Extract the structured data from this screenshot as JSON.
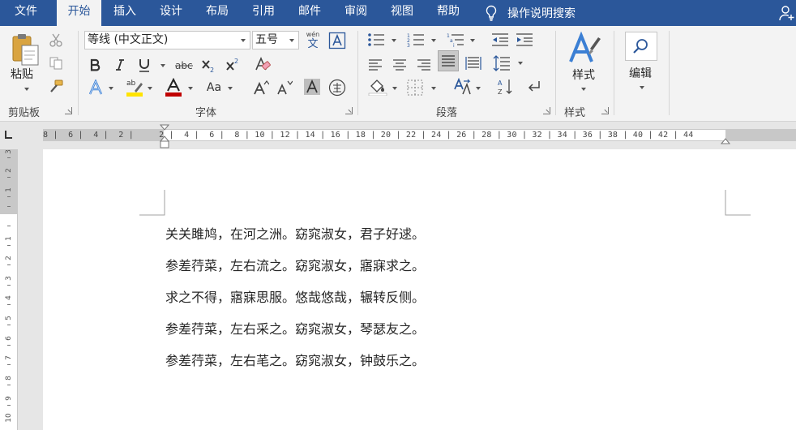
{
  "tabs": [
    {
      "label": "文件"
    },
    {
      "label": "开始"
    },
    {
      "label": "插入"
    },
    {
      "label": "设计"
    },
    {
      "label": "布局"
    },
    {
      "label": "引用"
    },
    {
      "label": "邮件"
    },
    {
      "label": "审阅"
    },
    {
      "label": "视图"
    },
    {
      "label": "帮助"
    }
  ],
  "tell_me": "操作说明搜索",
  "clipboard": {
    "paste_label": "粘贴",
    "group_label": "剪贴板"
  },
  "font": {
    "family": "等线 (中文正文)",
    "size": "五号",
    "group_label": "字体",
    "aa_label": "Aa",
    "phonetic_top": "wén",
    "phonetic_bottom": "文"
  },
  "paragraph": {
    "group_label": "段落"
  },
  "styles": {
    "button_label": "样式",
    "group_label": "样式"
  },
  "editing": {
    "button_label": "编辑"
  },
  "ruler": {
    "numbers": "8 |  6 |  4 |  2 |     2 |  4 |  6 |  8 | 10 | 12 | 14 | 16 | 18 | 20 | 22 | 24 | 26 | 28 | 30 | 32 | 34 | 36 | 38 | 40 | 42 | 44"
  },
  "vruler_numbers": [
    "3",
    "2",
    "1",
    "1",
    "2",
    "3",
    "4",
    "5",
    "6",
    "7",
    "8",
    "9",
    "10"
  ],
  "document": {
    "lines": [
      "关关雎鸠，在河之洲。窈窕淑女，君子好逑。",
      "参差荇菜，左右流之。窈窕淑女，寤寐求之。",
      "求之不得，寤寐思服。悠哉悠哉，辗转反侧。",
      "参差荇菜，左右采之。窈窕淑女，琴瑟友之。",
      "参差荇菜，左右芼之。窈窕淑女，钟鼓乐之。"
    ]
  }
}
